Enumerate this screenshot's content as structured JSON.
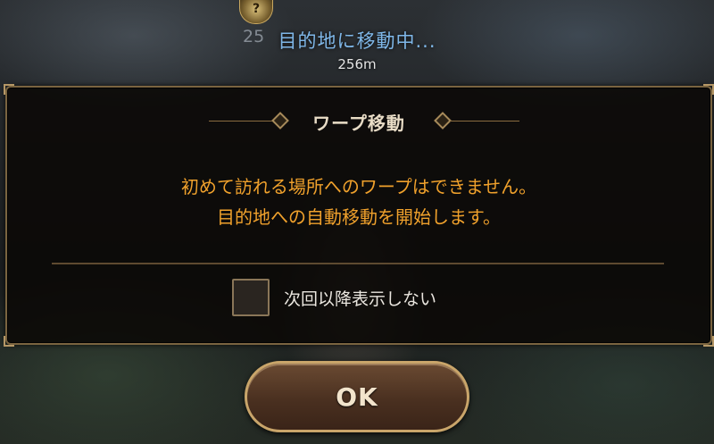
{
  "hud": {
    "marker_icon": "?",
    "obscured_number": "25",
    "navigation_status": "目的地に移動中...",
    "distance": "256m"
  },
  "dialog": {
    "title": "ワープ移動",
    "message_line1": "初めて訪れる場所へのワープはできません。",
    "message_line2": "目的地への自動移動を開始します。",
    "checkbox_label": "次回以降表示しない",
    "checkbox_checked": false,
    "ok_label": "OK"
  },
  "colors": {
    "message": "#f0a12c",
    "nav_title": "#7fb7e8",
    "frame": "#7a6440"
  }
}
